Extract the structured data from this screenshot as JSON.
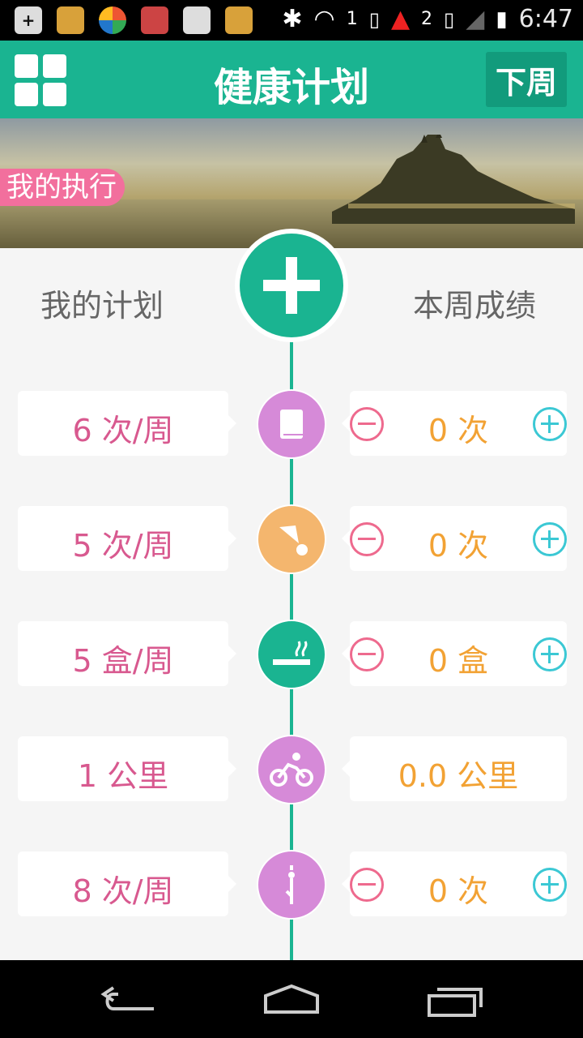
{
  "status_bar": {
    "time": "6:47",
    "sim1": "1",
    "sim2": "2",
    "app_icons": [
      "add-icon",
      "sogou-icon",
      "browser-icon",
      "signal-tool-icon",
      "ship-icon",
      "sogou-icon-2"
    ]
  },
  "header": {
    "title": "健康计划",
    "next_week_label": "下周"
  },
  "banner": {
    "tag_label": "我的执行"
  },
  "columns": {
    "plan_title": "我的计划",
    "score_title": "本周成绩"
  },
  "rows": [
    {
      "plan": "6 次/周",
      "score": "0 次",
      "icon": "book-icon",
      "color": "#d68ad8",
      "controls": true
    },
    {
      "plan": "5 次/周",
      "score": "0 次",
      "icon": "badminton-icon",
      "color": "#f4b66e",
      "controls": true
    },
    {
      "plan": "5 盒/周",
      "score": "0 盒",
      "icon": "cigarette-icon",
      "color": "#1ab491",
      "controls": true
    },
    {
      "plan": "1 公里",
      "score": "0.0 公里",
      "icon": "cycling-icon",
      "color": "#d68ad8",
      "controls": false
    },
    {
      "plan": "8 次/周",
      "score": "0 次",
      "icon": "yoga-icon",
      "color": "#d68ad8",
      "controls": true
    }
  ],
  "colors": {
    "primary": "#1ab491",
    "plan_text": "#d8598f",
    "score_text": "#f2a234",
    "minus": "#ee6a8e",
    "plus": "#3bc8d4",
    "tag": "#f26f9d"
  }
}
